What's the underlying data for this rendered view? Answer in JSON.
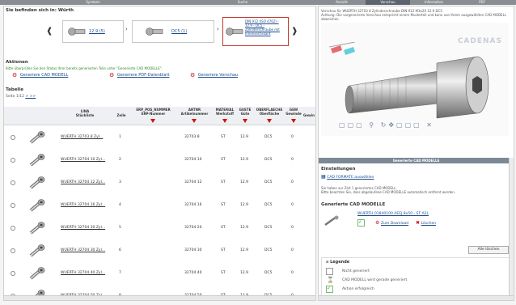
{
  "topbar": {
    "tabs": [
      "Symbole",
      "Suche",
      "Ansicht",
      "Vorschau",
      "Information",
      "PDF"
    ]
  },
  "left": {
    "location_label": "Sie befinden sich in: Würth",
    "breadcrumb": [
      {
        "label": "12.9 (5)"
      },
      {
        "label": "DC5 (1)"
      },
      {
        "label": "DIN 912 (ISO 4762) - 12.9 - DC5 - Zylinderschraube mit Innensechskant"
      }
    ],
    "actions": {
      "title": "Aktionen",
      "notice": "Bitte überprüfen Sie den Status Ihrer bereits generierten Teile unter \"Generierte CAD MODELLE\".",
      "buttons": [
        "Generiere CAD MODELL",
        "Generiere PDF-Datenblatt",
        "Generiere Vorschau"
      ]
    },
    "table": {
      "title": "Tabelle",
      "paging": "Seite 1/12",
      "paging_links": "> >>",
      "headers": {
        "lina": "LINA\nStückliste",
        "zeile": "Zeile",
        "erp": "ERP_POS_NUMMER\nERP-Nummer",
        "artnr": "ARTNR\nArtikelnummer",
        "material": "MATERIAL\nWerkstoff",
        "guete": "GUETE\nGüte",
        "oberflaeche": "OBERFLAECHE\nOberfläche",
        "gew": "GEW\nGewinde",
        "gewx": "Gewin"
      },
      "rows": [
        {
          "lina": "WUERTH 32703 8 Zyl...",
          "zeile": "1",
          "artnr": "32703 8",
          "material": "ST",
          "guete": "12.9",
          "ober": "DC5",
          "gew": "0"
        },
        {
          "lina": "WUERTH 32704 10 Zyl...",
          "zeile": "2",
          "artnr": "32704 10",
          "material": "ST",
          "guete": "12.9",
          "ober": "DC5",
          "gew": "0"
        },
        {
          "lina": "WUERTH 32704 12 Zyl...",
          "zeile": "3",
          "artnr": "32704 12",
          "material": "ST",
          "guete": "12.9",
          "ober": "DC5",
          "gew": "0"
        },
        {
          "lina": "WUERTH 32704 16 Zyl...",
          "zeile": "4",
          "artnr": "32704 16",
          "material": "ST",
          "guete": "12.9",
          "ober": "DC5",
          "gew": "0"
        },
        {
          "lina": "WUERTH 32704 20 Zyl...",
          "zeile": "5",
          "artnr": "32704 20",
          "material": "ST",
          "guete": "12.9",
          "ober": "DC5",
          "gew": "0"
        },
        {
          "lina": "WUERTH 32704 30 Zyl...",
          "zeile": "6",
          "artnr": "32704 30",
          "material": "ST",
          "guete": "12.9",
          "ober": "DC5",
          "gew": "0"
        },
        {
          "lina": "WUERTH 32704 40 Zyl...",
          "zeile": "7",
          "artnr": "32704 40",
          "material": "ST",
          "guete": "12.9",
          "ober": "DC5",
          "gew": "0"
        },
        {
          "lina": "WUERTH 32704 50 Zyl...",
          "zeile": "8",
          "artnr": "32704 50",
          "material": "ST",
          "guete": "12.9",
          "ober": "DC5",
          "gew": "0"
        }
      ]
    }
  },
  "right": {
    "preview_text": "Vorschau für WUERTH 32703 8 Zylinderschraube DIN 912 M3x20 12.9 DC5\nAchtung: Die vorgenerierte Vorschau entspricht einem Musterteil und kann von Ihrem ausgewählten CAD MODELL abweichen.",
    "logo_text": "CADENAS",
    "generated_bar": "Generierte CAD MODELLE",
    "settings_title": "Einstellungen",
    "cad_formats_link": "CAD FORMATE auswählen",
    "info_text": "Sie haben zur Zeit 1 generiertes CAD MODELL.\nBitte beachten Sie, dass abgelaufene CAD MODELLE automatisch entfernt werden.",
    "generated_title": "Generierte CAD MODELLE",
    "generated_item": "WUERTH 01840100 AEEJ 8x50 - ST A2L",
    "download_label": "Zum Download",
    "delete_label": "Löschen",
    "delete_all": "Alle löschen",
    "legend_title": "Legende",
    "legend": [
      "Nicht generiert",
      "CAD MODELL wird gerade generiert",
      "Aktion erfolgreich"
    ]
  },
  "colors": {
    "accent_red": "#d01010",
    "link_blue": "#1a4c8c",
    "header_grey": "#8a8d92"
  }
}
